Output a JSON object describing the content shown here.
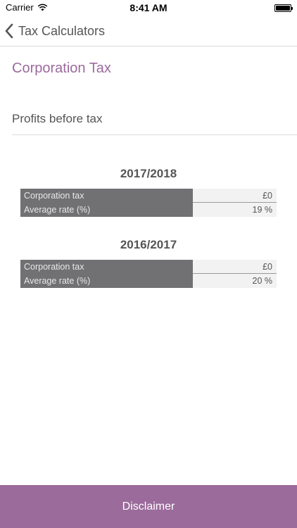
{
  "status": {
    "carrier": "Carrier",
    "time": "8:41 AM",
    "wifi_icon": "wifi-icon",
    "battery_icon": "battery-icon",
    "battery_level": 1.0
  },
  "nav": {
    "back_label": "Tax Calculators",
    "back_icon": "chevron-left-icon"
  },
  "page": {
    "title": "Corporation Tax"
  },
  "input": {
    "label": "Profits before tax"
  },
  "results": [
    {
      "year": "2017/2018",
      "rows": [
        {
          "label": "Corporation tax",
          "value": "£0"
        },
        {
          "label": "Average rate (%)",
          "value": "19 %"
        }
      ]
    },
    {
      "year": "2016/2017",
      "rows": [
        {
          "label": "Corporation tax",
          "value": "£0"
        },
        {
          "label": "Average rate (%)",
          "value": "20 %"
        }
      ]
    }
  ],
  "footer": {
    "label": "Disclaimer"
  },
  "colors": {
    "accent": "#9b6a9d",
    "table_label_bg": "#717173",
    "table_value_bg": "#f2f2f2"
  }
}
